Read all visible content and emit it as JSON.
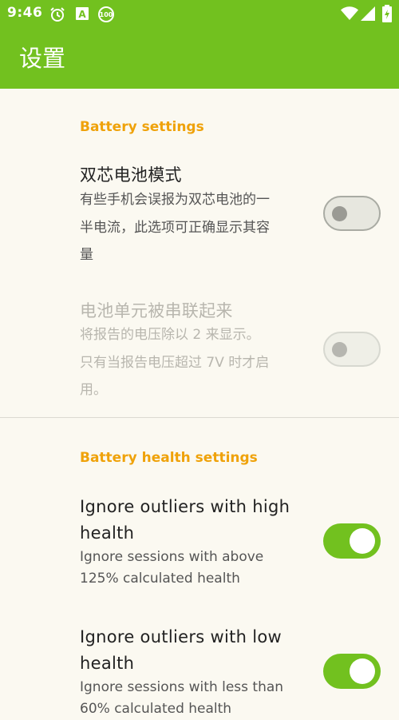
{
  "status_bar": {
    "time": "9:46",
    "left_icons": [
      "alarm-clock-icon",
      "font-a-icon",
      "battery-100-badge-icon"
    ],
    "badge_text": "100",
    "a_text": "A",
    "right_icons": [
      "wifi-icon",
      "signal-icon",
      "battery-charging-icon"
    ]
  },
  "app_bar": {
    "title": "设置",
    "color": "#72c11f"
  },
  "sections": [
    {
      "header": "Battery settings",
      "items": [
        {
          "title": "双芯电池模式",
          "subtitle_lines": [
            "有些手机会误报为双芯电池的一",
            "半电流，此选项可正确显示其容",
            "量"
          ],
          "enabled": true,
          "checked": false
        },
        {
          "title": "电池单元被串联起来",
          "subtitle_lines": [
            "将报告的电压除以 2 来显示。",
            "只有当报告电压超过 7V 时才启",
            "用。"
          ],
          "enabled": false,
          "checked": false
        }
      ]
    },
    {
      "header": "Battery health settings",
      "items": [
        {
          "title_lines": [
            "Ignore outliers with high",
            "health"
          ],
          "subtitle_lines": [
            "Ignore sessions with above",
            "125% calculated health"
          ],
          "enabled": true,
          "checked": true
        },
        {
          "title_lines": [
            "Ignore outliers with low",
            "health"
          ],
          "subtitle_lines": [
            "Ignore sessions with less than",
            "60% calculated health"
          ],
          "enabled": true,
          "checked": true
        }
      ]
    }
  ],
  "colors": {
    "accent": "#efa20a",
    "switch_on": "#72c11f",
    "background": "#fbf9f1"
  }
}
